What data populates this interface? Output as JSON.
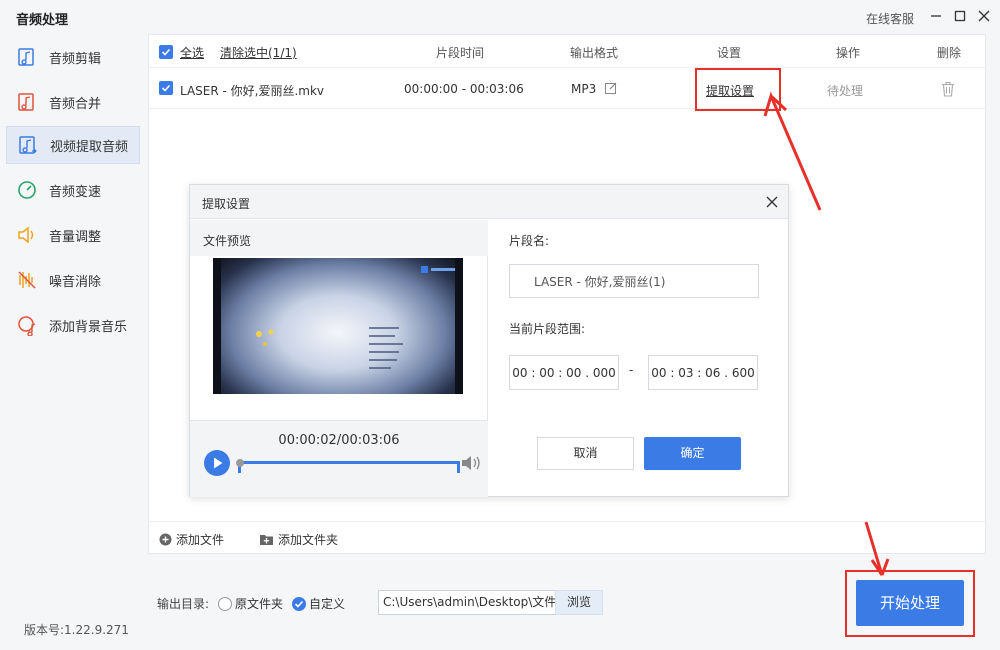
{
  "app": {
    "title": "音频处理",
    "service_label": "在线客服",
    "version": "版本号:1.22.9.271"
  },
  "sidebar": {
    "items": [
      {
        "label": "音频剪辑",
        "icon": "audio-cut-icon"
      },
      {
        "label": "音频合并",
        "icon": "audio-merge-icon"
      },
      {
        "label": "视频提取音频",
        "icon": "video-extract-audio-icon",
        "active": true
      },
      {
        "label": "音频变速",
        "icon": "speed-icon"
      },
      {
        "label": "音量调整",
        "icon": "volume-icon"
      },
      {
        "label": "噪音消除",
        "icon": "noise-icon"
      },
      {
        "label": "添加背景音乐",
        "icon": "music-note-icon"
      }
    ]
  },
  "table": {
    "select_all": "全选",
    "clear_selected": "清除选中(1/1)",
    "columns": {
      "segment_time": "片段时间",
      "output_format": "输出格式",
      "settings": "设置",
      "action": "操作",
      "delete": "删除"
    },
    "rows": [
      {
        "file_name": "LASER - 你好,爱丽丝.mkv",
        "time_range": "00:00:00 - 00:03:06",
        "format": "MP3",
        "settings_link": "提取设置",
        "status": "待处理"
      }
    ]
  },
  "add_bar": {
    "add_file": "添加文件",
    "add_folder": "添加文件夹"
  },
  "output": {
    "label": "输出目录:",
    "option_original": "原文件夹",
    "option_custom": "自定义",
    "path": "C:\\Users\\admin\\Desktop\\文件",
    "browse": "浏览",
    "start": "开始处理"
  },
  "dialog": {
    "title": "提取设置",
    "preview_label": "文件预览",
    "playback_time": "00:00:02/00:03:06",
    "segment_name_label": "片段名:",
    "segment_name": "LASER - 你好,爱丽丝(1)",
    "range_label": "当前片段范围:",
    "range_start": "00 : 00 : 00 . 000",
    "range_separator": "-",
    "range_end": "00 : 03 : 06 . 600",
    "cancel": "取消",
    "confirm": "确定"
  },
  "colors": {
    "accent": "#3b7be6",
    "highlight": "#e6302a"
  }
}
